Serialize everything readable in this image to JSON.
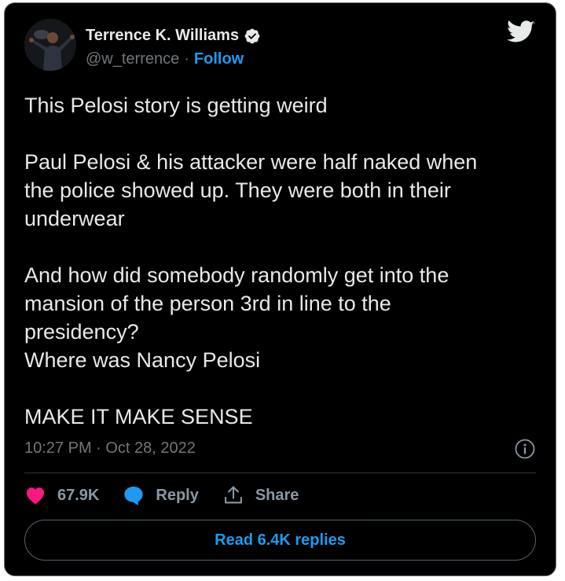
{
  "user": {
    "name": "Terrence K. Williams",
    "handle": "@w_terrence",
    "separator": "·",
    "follow_label": "Follow"
  },
  "tweet": {
    "paragraphs": [
      [
        "This Pelosi story is getting weird"
      ],
      [
        "Paul Pelosi & his attacker were half naked when",
        "the police showed up. They were both in their",
        "underwear"
      ],
      [
        "And how did somebody randomly get into the",
        "mansion of the person 3rd in line to the",
        "presidency?",
        "Where was Nancy Pelosi"
      ],
      [
        "MAKE IT MAKE SENSE"
      ]
    ],
    "timestamp": "10:27 PM · Oct 28, 2022"
  },
  "actions": {
    "likes": "67.9K",
    "reply_label": "Reply",
    "share_label": "Share"
  },
  "read_replies_label": "Read 6.4K replies",
  "colors": {
    "background": "#000000",
    "accent": "#1d9bf0",
    "like": "#f91880",
    "muted": "#71767b"
  },
  "icons": [
    "verified-badge-icon",
    "twitter-bird-icon",
    "info-icon",
    "heart-icon",
    "reply-bubble-icon",
    "share-icon"
  ]
}
